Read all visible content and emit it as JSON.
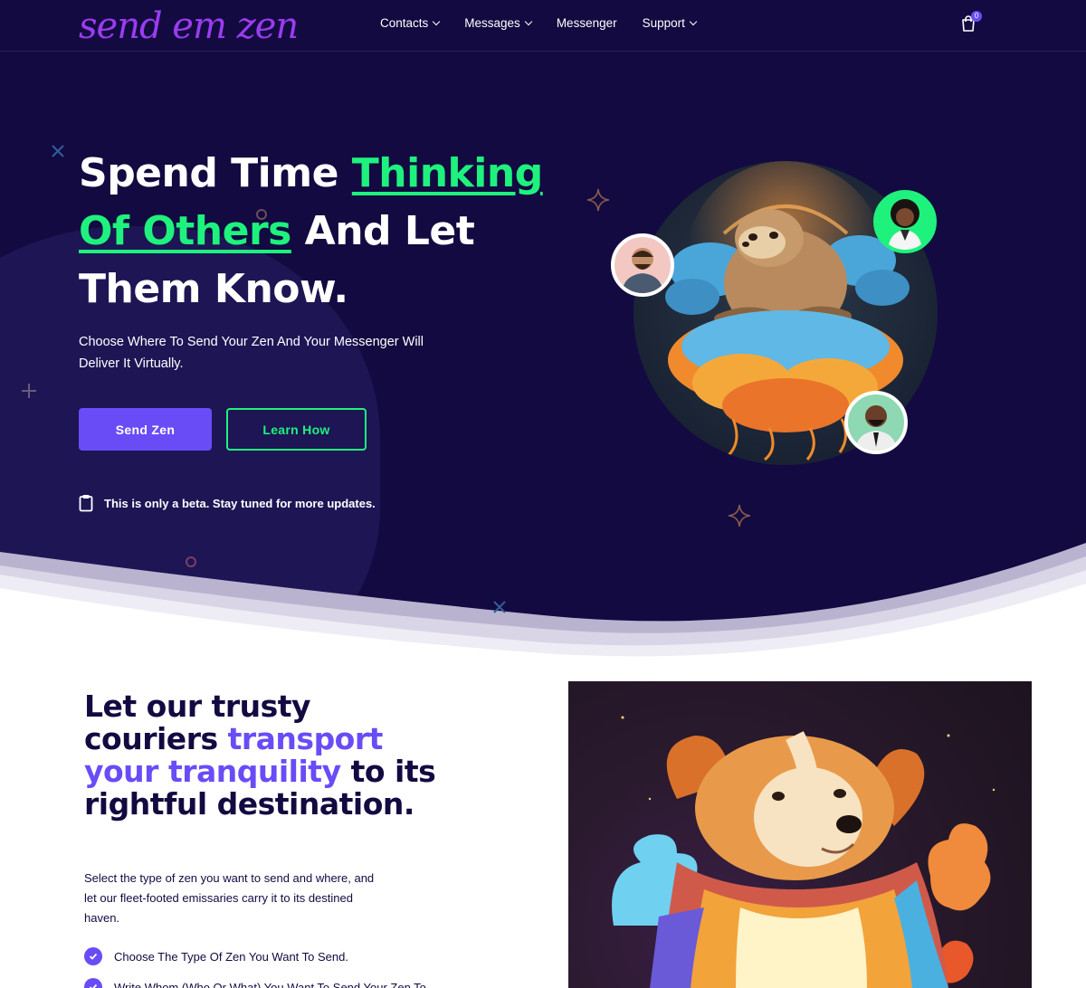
{
  "nav": {
    "logo": "send em zen",
    "items": [
      {
        "label": "Contacts",
        "has_dropdown": true
      },
      {
        "label": "Messages",
        "has_dropdown": true
      },
      {
        "label": "Messenger",
        "has_dropdown": false
      },
      {
        "label": "Support",
        "has_dropdown": true
      }
    ],
    "cart_count": "0"
  },
  "hero": {
    "title_part1": "Spend Time ",
    "title_highlight1": "Thinking",
    "title_highlight2": "Of Others",
    "title_part2": " And Let Them Know.",
    "subtitle": "Choose Where To Send Your Zen And Your Messenger Will Deliver It Virtually.",
    "primary_button": "Send Zen",
    "secondary_button": "Learn How",
    "beta_note": "This is only a beta. Stay tuned for more updates."
  },
  "section2": {
    "title_part1": "Let our trusty couriers ",
    "title_accent": "transport your tranquility",
    "title_part2": " to its rightful destination.",
    "subtitle": "Select the type of zen you want to send and where, and let our fleet-footed emissaries carry it to its destined haven.",
    "checklist": [
      "Choose The Type Of Zen You Want To Send.",
      "Write Whom (Who Or What) You Want To Send Your Zen To."
    ]
  },
  "colors": {
    "hero_bg": "#130a41",
    "brand_purple": "#6a4cf7",
    "accent_green": "#1ef27d",
    "logo_purple": "#9b3cf0",
    "dark_text": "#130a41"
  },
  "icons": {
    "cart": "shopping-bag-icon",
    "beta": "clipboard-icon",
    "check": "check-circle-icon",
    "chevron": "chevron-down-icon"
  }
}
